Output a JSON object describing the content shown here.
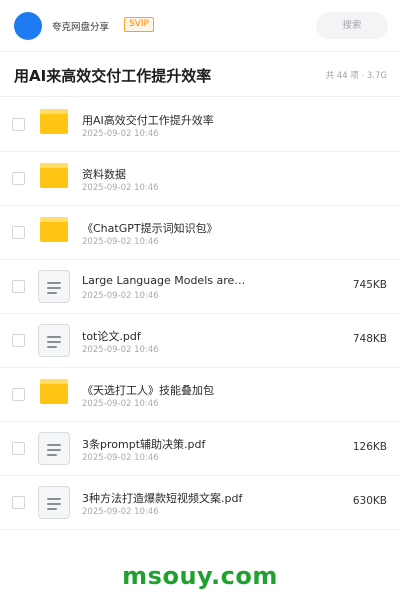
{
  "header": {
    "share_name": "夸克网盘分享",
    "badge": "SVIP",
    "search_placeholder": "搜索",
    "accent_color": "#1e7bf2",
    "badge_color": "#ff8a00"
  },
  "folder": {
    "title": "用AI来高效交付工作提升效率",
    "summary": "共 44 项 · 3.7G"
  },
  "files": [
    {
      "type": "folder",
      "icon": "folder-icon",
      "name": "用AI高效交付工作提升效率",
      "date": "2025-09-02 10:46",
      "size": ""
    },
    {
      "type": "folder",
      "icon": "folder-icon",
      "name": "资料数据",
      "date": "2025-09-02 10:46",
      "size": ""
    },
    {
      "type": "folder",
      "icon": "folder-icon",
      "name": "《ChatGPT提示词知识包》",
      "date": "2025-09-02 10:46",
      "size": ""
    },
    {
      "type": "file",
      "icon": "document-icon",
      "name": "Large Language Models are…",
      "date": "2025-09-02 10:46",
      "size": "745KB"
    },
    {
      "type": "file",
      "icon": "document-icon",
      "name": "tot论文.pdf",
      "date": "2025-09-02 10:46",
      "size": "748KB"
    },
    {
      "type": "folder",
      "icon": "folder-icon",
      "name": "《天选打工人》技能叠加包",
      "date": "2025-09-02 10:46",
      "size": ""
    },
    {
      "type": "file",
      "icon": "document-icon",
      "name": "3条prompt辅助决策.pdf",
      "date": "2025-09-02 10:46",
      "size": "126KB"
    },
    {
      "type": "file",
      "icon": "document-icon",
      "name": "3种方法打造爆款短视频文案.pdf",
      "date": "2025-09-02 10:46",
      "size": "630KB"
    }
  ],
  "watermark": "msouy.com"
}
